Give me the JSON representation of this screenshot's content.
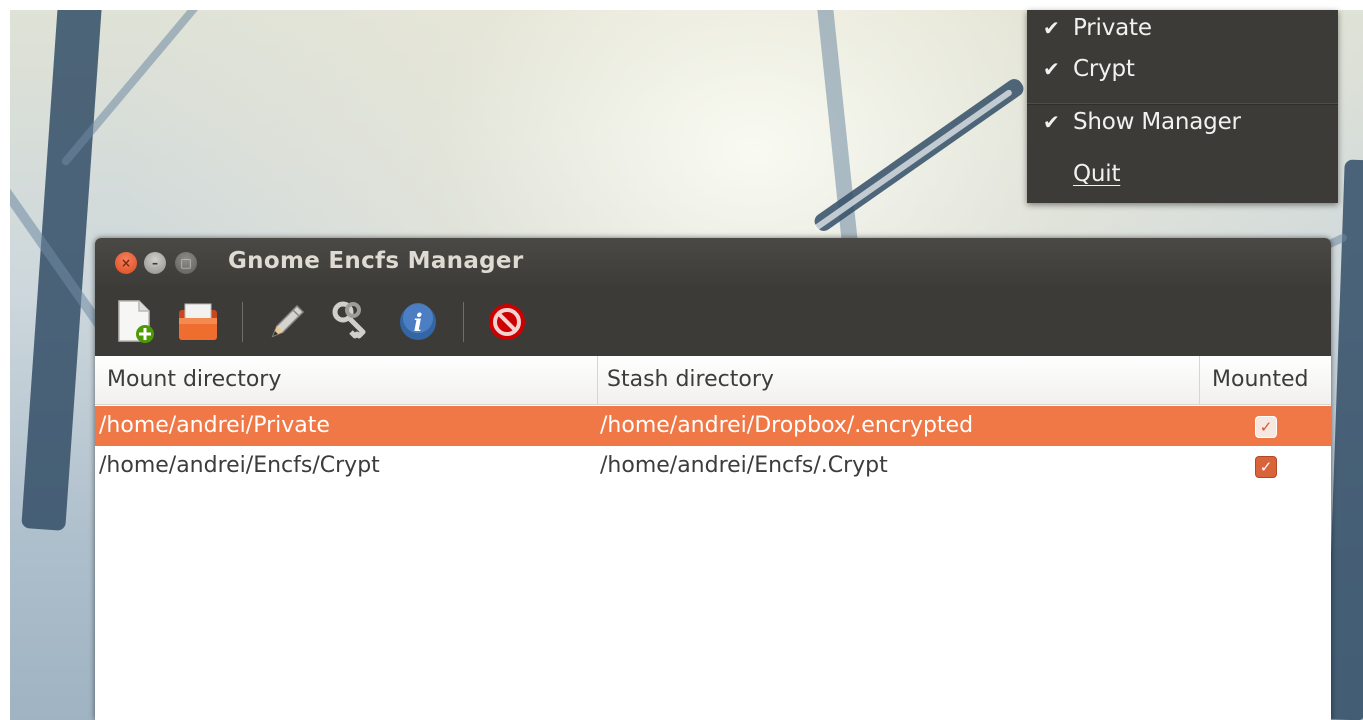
{
  "tray_menu": {
    "items": [
      {
        "label": "Private",
        "checked": true
      },
      {
        "label": "Crypt",
        "checked": true
      },
      {
        "label": "Show Manager",
        "checked": true
      },
      {
        "label": "Quit",
        "checked": false
      }
    ],
    "check_glyph": "✔"
  },
  "window": {
    "title": "Gnome Encfs Manager",
    "buttons": {
      "close": "×",
      "minimize": "–",
      "maximize": "□"
    }
  },
  "toolbar": {
    "tools": [
      {
        "name": "new-stash-icon"
      },
      {
        "name": "import-stash-icon"
      },
      {
        "name": "edit-icon"
      },
      {
        "name": "keys-icon"
      },
      {
        "name": "info-icon"
      },
      {
        "name": "stop-icon"
      }
    ]
  },
  "list": {
    "columns": [
      "Mount directory",
      "Stash directory",
      "Mounted"
    ],
    "rows": [
      {
        "mount": "/home/andrei/Private",
        "stash": "/home/andrei/Dropbox/.encrypted",
        "mounted": true,
        "selected": true
      },
      {
        "mount": "/home/andrei/Encfs/Crypt",
        "stash": "/home/andrei/Encfs/.Crypt",
        "mounted": true,
        "selected": false
      }
    ],
    "checkbox_glyph": "✓"
  },
  "colors": {
    "selection": "#f07746",
    "panel": "#3c3b37",
    "accent": "#d9643a"
  }
}
